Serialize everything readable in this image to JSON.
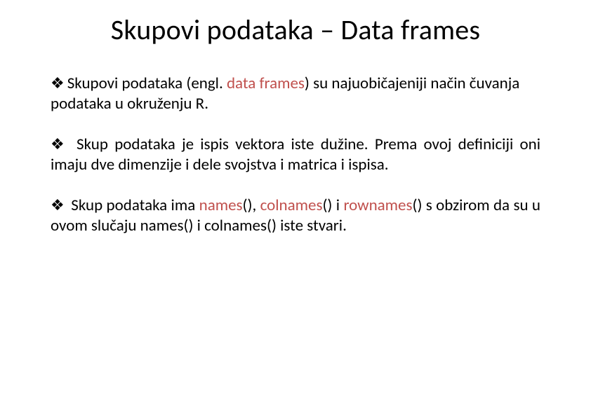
{
  "title": "Skupovi podataka – Data frames",
  "bullets": {
    "b1": {
      "t1": "Skupovi podataka (engl. ",
      "t2": "data frames",
      "t3": ") su najuobičajeniji način čuvanja podataka u okruženju R."
    },
    "b2": {
      "t1": " Skup podataka je ispis vektora iste dužine. Prema ovoj definiciji oni imaju dve dimenzije i dele svojstva i matrica i ispisa."
    },
    "b3": {
      "t1": " Skup podataka ima ",
      "t2": "names",
      "t3": "(), ",
      "t4": "colnames",
      "t5": "() i  ",
      "t6": "rownames",
      "t7": "() s obzirom da su u ovom slučaju names() i colnames() iste stvari."
    }
  }
}
